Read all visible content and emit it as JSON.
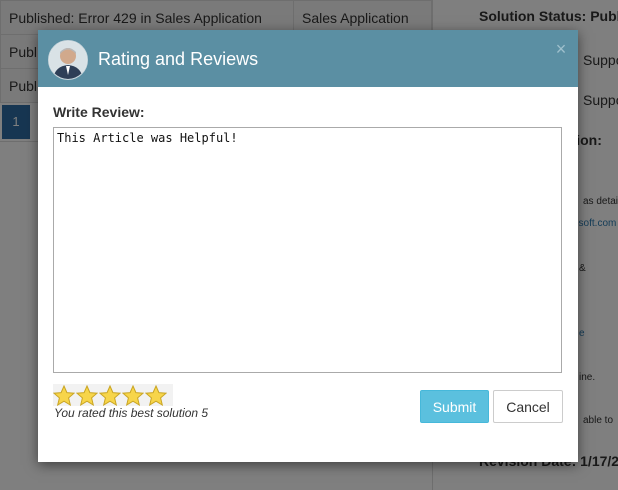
{
  "background": {
    "rows": [
      {
        "title": "Published: Error 429 in Sales Application",
        "module": "Sales Application"
      },
      {
        "title": "Publ",
        "module": ""
      },
      {
        "title": "Publ",
        "module": ""
      }
    ],
    "page_number": "1",
    "right_panel": {
      "solution_status_label": "Solution Status: Publ",
      "support1": "Suppo",
      "support2": "Suppo",
      "description_label": "ption:",
      "text_detail": "as detai",
      "link1": "osoft.com",
      "amp": "&",
      "link2": "e",
      "text_line": "ine.",
      "text_able": "able to",
      "revision_label": "Revision Date: 1/17/2"
    }
  },
  "modal": {
    "title": "Rating and Reviews",
    "close_symbol": "×",
    "review_label": "Write Review:",
    "review_text": "This Article was Helpful!",
    "rating": 5,
    "max_rating": 5,
    "rating_text": "You rated this best solution 5",
    "submit_label": "Submit",
    "cancel_label": "Cancel"
  },
  "colors": {
    "header": "#5b8fa3",
    "submit": "#5bc0de",
    "star": "#f7d54a",
    "pager_active": "#2e6da4"
  }
}
